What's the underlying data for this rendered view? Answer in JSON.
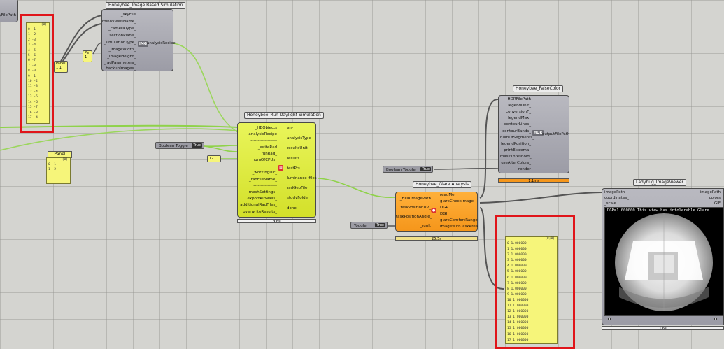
{
  "top_left_stub": {
    "label": "skyFilePath"
  },
  "image_sim": {
    "title": "Honeybee_Image Based Simulation",
    "inputs": [
      "_skyFile",
      "rhinoViewsName_",
      "_cameraType_",
      "sectionPlane_",
      "_simulationType_",
      "_imageWidth_",
      "_imageHeight_",
      "_radParameters_",
      "backupImages_"
    ],
    "output": "analysisRecipe",
    "center": "IMG"
  },
  "panel_tl": {
    "header": "{0}",
    "rows": [
      "0 -1",
      "1 -2",
      "2 -3",
      "3 -4",
      "4 -5",
      "5 -6",
      "6 -7",
      "7 -8",
      "8 -0",
      "9 -1",
      "10 -2",
      "11 -3",
      "12 -4",
      "13 -5",
      "14 -6",
      "15 -7",
      "16 -8",
      "17 -4"
    ]
  },
  "panel_stub": {
    "label": "Panel",
    "value": "1 1"
  },
  "pa_stub": {
    "label": "Pa",
    "value": "1"
  },
  "panel_mid": {
    "title": "Panel",
    "header": "{0}",
    "rows": [
      "0 -1",
      "1 -2"
    ]
  },
  "run_sim": {
    "title": "Honeybee_Run Daylight Simulation",
    "inputs": [
      "_HBObjects",
      "_analysisRecipe",
      "-------------------",
      "_writeRad",
      "runRad_",
      "_numOfCPUs_",
      "------------------",
      "_workingDir_",
      "_radFileName_",
      "-----------------",
      "meshSettings_",
      "exportAirWalls_",
      "additionalRadFiles_",
      "overwriteResults_"
    ],
    "outputs": [
      "out",
      "analysisType",
      "resultsUnit",
      "results",
      "testPts",
      "luminance_files",
      "radGeoFile",
      "studyFolder",
      "done"
    ],
    "timer": "9.6s"
  },
  "bool_toggle_1": {
    "label": "Boolean Toggle",
    "value": "True"
  },
  "num_node": {
    "value": "12"
  },
  "falsecolor": {
    "title": "Honeybee_FalseColor",
    "inputs": [
      "_HDRFilePath",
      "legendUnit_",
      "conversionF_",
      "legendMax_",
      "contourLines_",
      "contourBands_",
      "numOfSegments_",
      "legendPosition_",
      "printExtrema_",
      "maskThreshold_",
      "useAlterColors_",
      "_render"
    ],
    "output": "outputFilePath",
    "center": "HDR",
    "timer": "1.1ms"
  },
  "bool_toggle_2": {
    "label": "Boolean Toggle",
    "value": "True"
  },
  "glare": {
    "title": "Honeybee_Glare Analysis",
    "inputs": [
      "_HDRImagePath",
      "taskPositionUV_",
      "taskPositionAngle_",
      "_runIt"
    ],
    "outputs": [
      "readMe",
      "glareCheckImage",
      "DGP",
      "DGI",
      "glareComfortRange",
      "imageWithTaskArea"
    ],
    "timer": "25.5s"
  },
  "toggle_3": {
    "label": "Toggle",
    "value": "True"
  },
  "panel_br": {
    "header": "{0;0}",
    "rows": [
      "0 1.000000",
      "1 1.000000",
      "2 1.000000",
      "3 1.000000",
      "4 1.000000",
      "5 1.000000",
      "6 1.000000",
      "7 1.000000",
      "8 1.000000",
      "9 1.000000",
      "10 1.000000",
      "11 1.000000",
      "12 1.000000",
      "13 1.000000",
      "14 1.000000",
      "15 1.000000",
      "16 1.000000",
      "17 1.000000"
    ]
  },
  "viewer": {
    "title": "Ladybug_ImageViewer",
    "inputs": [
      "imagePath_",
      "coordinates_",
      "_scale"
    ],
    "outputs": [
      "imagePath",
      "colors",
      "GIF"
    ],
    "caption": "DGP=1.000000 This view has intolerable Glare",
    "timer": "1.6s"
  },
  "colors": {
    "wire_green": "#8fd24a",
    "wire_gray": "#555555",
    "highlight_red": "#e0151a"
  }
}
